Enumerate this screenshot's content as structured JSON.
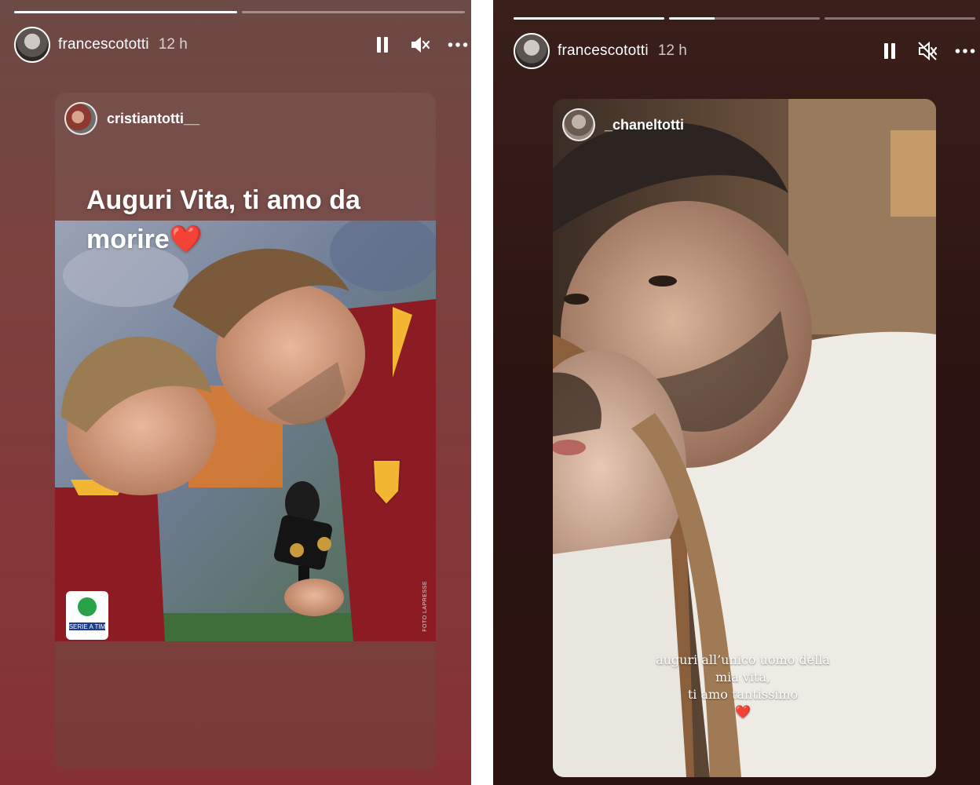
{
  "stories": [
    {
      "user": {
        "username": "francescototti",
        "time": "12 h"
      },
      "progress": [
        1,
        0,
        0,
        0
      ],
      "controls": {
        "pause": "pause-icon",
        "mute": "muted-speaker-icon",
        "more": "more-icon"
      },
      "mention": {
        "username": "cristiantotti__"
      },
      "caption": {
        "line1": "Auguri Vita, ti amo da",
        "line2": "morire",
        "emoji": "❤️"
      },
      "photo_credit": "FOTO LAPRESSE",
      "badge": "SERIE A TIM"
    },
    {
      "user": {
        "username": "francescototti",
        "time": "12 h"
      },
      "progress": [
        1,
        0.3,
        0
      ],
      "controls": {
        "pause": "pause-icon",
        "mute": "muted-speaker-icon",
        "more": "more-icon"
      },
      "mention": {
        "username": "_chaneltotti"
      },
      "caption": {
        "line1": "auguri all’unico uomo della",
        "line2": "mia vita,",
        "line3": "ti amo tantissimo",
        "emoji": "❤️"
      }
    }
  ],
  "colors": {
    "story_left_bg": "#7a433f",
    "story_right_bg": "#2a1310",
    "roma_red": "#8c1b24",
    "roma_gold": "#f2b632"
  }
}
